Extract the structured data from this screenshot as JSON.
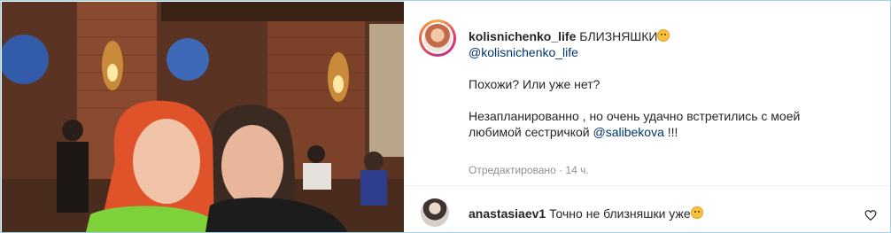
{
  "post": {
    "username": "kolisnichenko_life",
    "title_text": "БЛИЗНЯШКИ",
    "title_emoji": "smiling-face-emoji",
    "mention_line": "@kolisnichenko_life",
    "line1": "Похожи? Или уже нет?",
    "line2": "Незапланированно , но очень удачно встретились с моей",
    "line3_prefix": "любимой сестричкой ",
    "line3_mention": "@salibekova",
    "line3_suffix": " !!!",
    "edited_label": "Отредактировано",
    "separator": " · ",
    "time_ago": "14 ч."
  },
  "comment": {
    "username": "anastasiaev1",
    "text": "Точно не близняшки уже",
    "emoji": "relieved-face-emoji"
  },
  "colors": {
    "frame_border": "#9fd4e8",
    "mention": "#00376b",
    "meta": "#8e8e8e"
  }
}
